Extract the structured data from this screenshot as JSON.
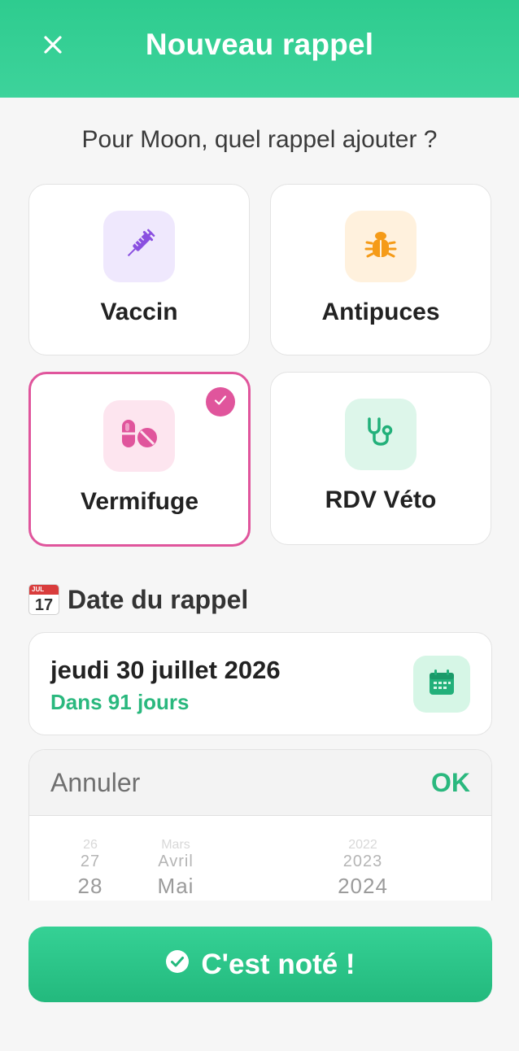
{
  "header": {
    "title": "Nouveau rappel"
  },
  "question": "Pour Moon, quel rappel ajouter ?",
  "reminder_types": [
    {
      "label": "Vaccin",
      "icon": "syringe-icon",
      "icon_color": "#8a4fe0",
      "tile_bg": "#efe8fd",
      "selected": false
    },
    {
      "label": "Antipuces",
      "icon": "bug-icon",
      "icon_color": "#f59b18",
      "tile_bg": "#fff1dd",
      "selected": false
    },
    {
      "label": "Vermifuge",
      "icon": "pills-icon",
      "icon_color": "#e0559c",
      "tile_bg": "#fde5ef",
      "selected": true
    },
    {
      "label": "RDV Véto",
      "icon": "stethoscope-icon",
      "icon_color": "#22b07a",
      "tile_bg": "#ddf6ea",
      "selected": false
    }
  ],
  "date_section": {
    "title": "Date du rappel",
    "calendar_emoji_month": "JUL",
    "calendar_emoji_day": "17",
    "date_value": "jeudi 30 juillet 2026",
    "relative": "Dans 91 jours"
  },
  "picker": {
    "cancel_label": "Annuler",
    "ok_label": "OK",
    "day": {
      "faint": "26",
      "mid": "27",
      "near": "28"
    },
    "month": {
      "faint": "Mars",
      "mid": "Avril",
      "near": "Mai"
    },
    "year": {
      "faint": "2022",
      "mid": "2023",
      "near": "2024"
    }
  },
  "submit_label": "C'est noté !",
  "colors": {
    "accent": "#2ab87e",
    "selected_border": "#e0559c",
    "header_bg": "#2ecc8f"
  }
}
